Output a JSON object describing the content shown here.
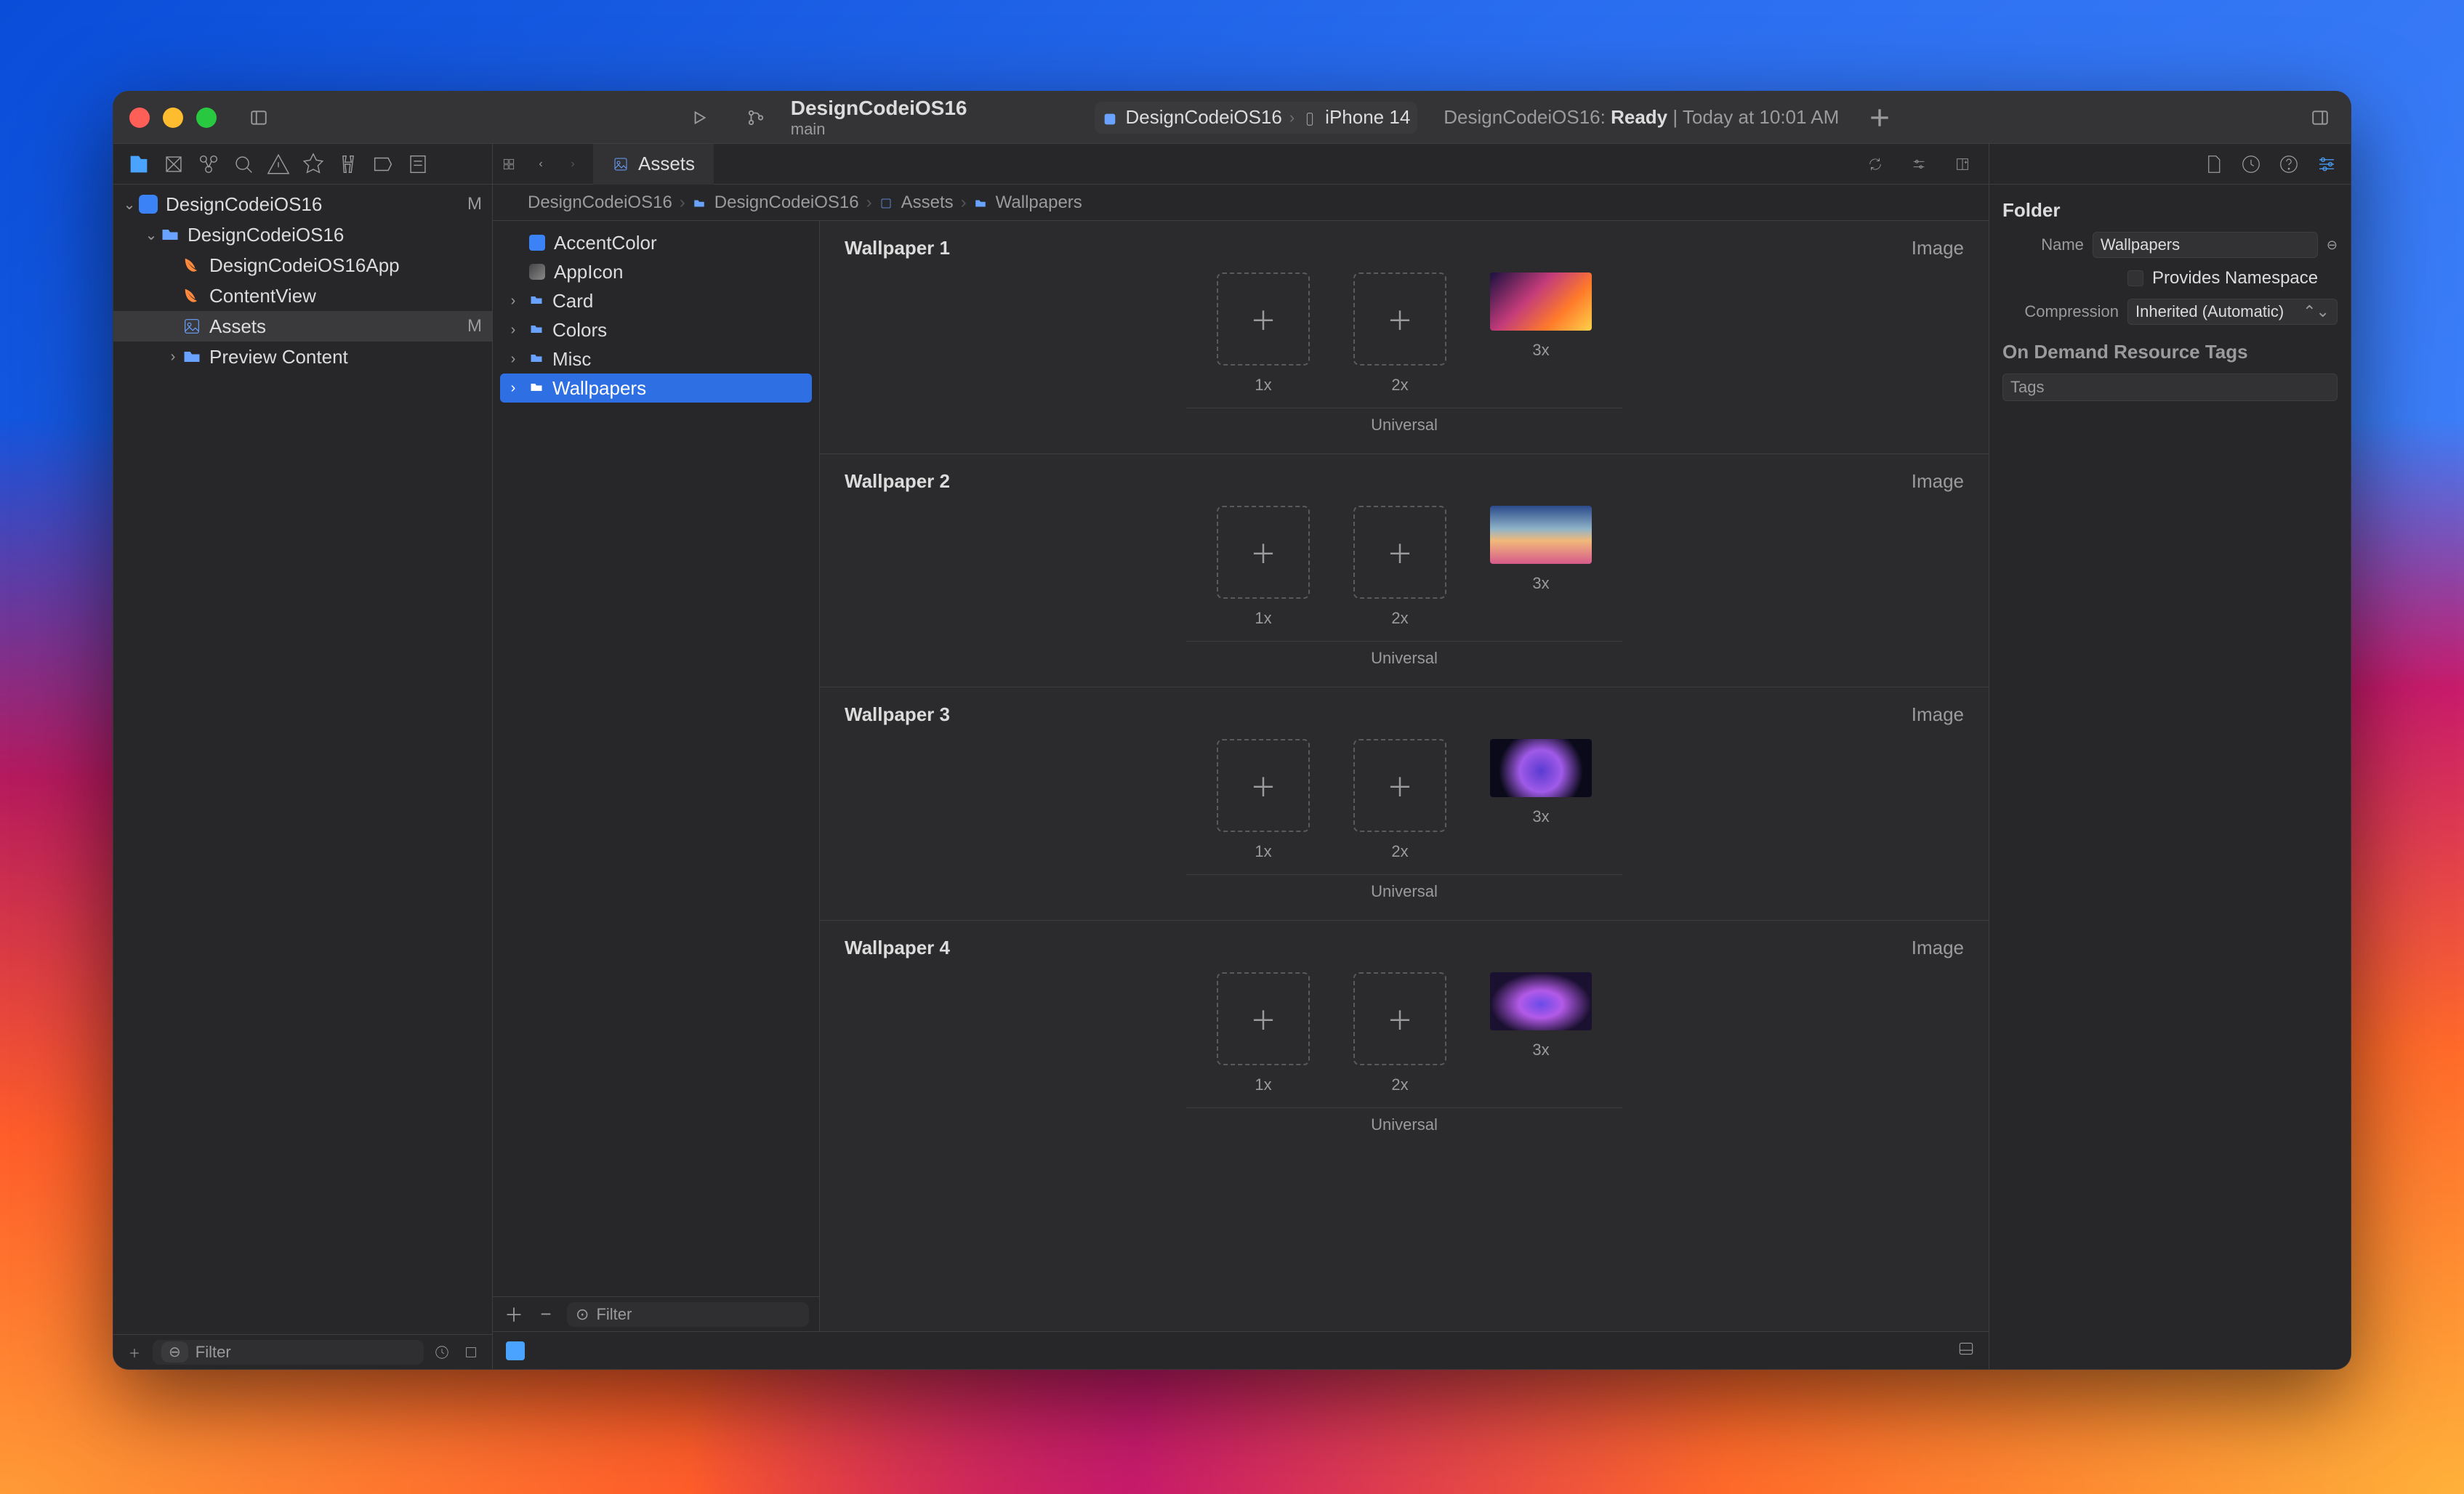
{
  "titlebar": {
    "project": "DesignCodeiOS16",
    "branch": "main",
    "scheme_target": "DesignCodeiOS16",
    "scheme_device": "iPhone 14",
    "status_prefix": "DesignCodeiOS16:",
    "status_state": "Ready",
    "status_time": "Today at 10:01 AM"
  },
  "navigator": {
    "project": "DesignCodeiOS16",
    "project_badge": "M",
    "group": "DesignCodeiOS16",
    "files": [
      {
        "name": "DesignCodeiOS16App",
        "kind": "swift"
      },
      {
        "name": "ContentView",
        "kind": "swift"
      },
      {
        "name": "Assets",
        "kind": "assets",
        "badge": "M",
        "selected": true
      },
      {
        "name": "Preview Content",
        "kind": "folder"
      }
    ],
    "filter_placeholder": "Filter"
  },
  "tabs": {
    "assets_tab": "Assets"
  },
  "breadcrumb": [
    "DesignCodeiOS16",
    "DesignCodeiOS16",
    "Assets",
    "Wallpapers"
  ],
  "asset_list": [
    {
      "name": "AccentColor",
      "kind": "color",
      "swatch": "#3b82f6"
    },
    {
      "name": "AppIcon",
      "kind": "appicon"
    },
    {
      "name": "Card",
      "kind": "folder"
    },
    {
      "name": "Colors",
      "kind": "folder"
    },
    {
      "name": "Misc",
      "kind": "folder"
    },
    {
      "name": "Wallpapers",
      "kind": "folder",
      "selected": true
    }
  ],
  "asset_filter_placeholder": "Filter",
  "images": [
    {
      "title": "Wallpaper 1",
      "type_label": "Image",
      "slots": [
        "1x",
        "2x",
        "3x"
      ],
      "universal": "Universal",
      "thumb": "thumb1"
    },
    {
      "title": "Wallpaper 2",
      "type_label": "Image",
      "slots": [
        "1x",
        "2x",
        "3x"
      ],
      "universal": "Universal",
      "thumb": "thumb2"
    },
    {
      "title": "Wallpaper 3",
      "type_label": "Image",
      "slots": [
        "1x",
        "2x",
        "3x"
      ],
      "universal": "Universal",
      "thumb": "thumb3"
    },
    {
      "title": "Wallpaper 4",
      "type_label": "Image",
      "slots": [
        "1x",
        "2x",
        "3x"
      ],
      "universal": "Universal",
      "thumb": "thumb4"
    }
  ],
  "inspector": {
    "section": "Folder",
    "name_label": "Name",
    "name_value": "Wallpapers",
    "namespace_label": "Provides Namespace",
    "compression_label": "Compression",
    "compression_value": "Inherited (Automatic)",
    "tags_section": "On Demand Resource Tags",
    "tags_placeholder": "Tags"
  }
}
